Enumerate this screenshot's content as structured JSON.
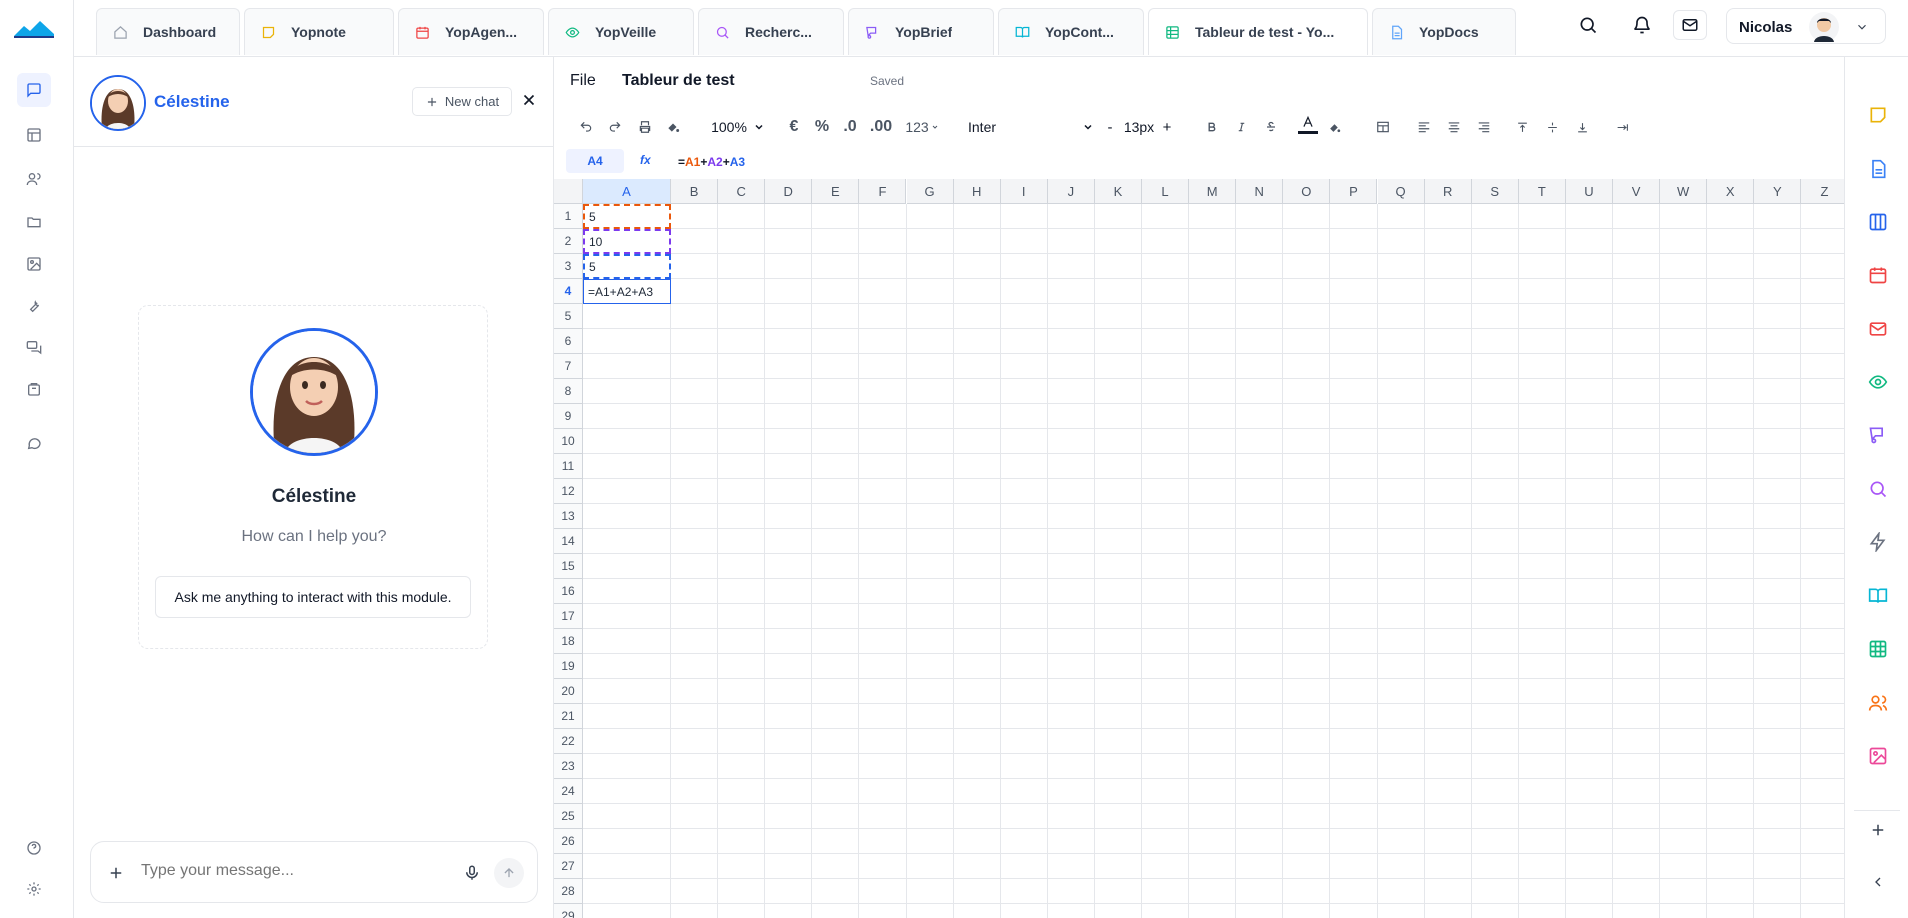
{
  "tabs": [
    {
      "label": "Dashboard",
      "icon": "home-icon"
    },
    {
      "label": "Yopnote",
      "icon": "note-icon"
    },
    {
      "label": "YopAgen...",
      "icon": "calendar-icon"
    },
    {
      "label": "YopVeille",
      "icon": "eye-icon"
    },
    {
      "label": "Recherc...",
      "icon": "search-icon"
    },
    {
      "label": "YopBrief",
      "icon": "brief-icon"
    },
    {
      "label": "YopCont...",
      "icon": "book-icon"
    },
    {
      "label": "Tableur de test - Yo...",
      "icon": "table-icon"
    },
    {
      "label": "YopDocs",
      "icon": "doc-icon"
    }
  ],
  "user": {
    "name": "Nicolas"
  },
  "chat": {
    "assistant_name": "Célestine",
    "new_chat_label": "New chat",
    "greeting": "How can I help you?",
    "suggestion": "Ask me anything to interact with this module.",
    "input_placeholder": "Type your message..."
  },
  "sheet": {
    "file_menu": "File",
    "title": "Tableur de test",
    "status": "Saved",
    "zoom": "100%",
    "currency": "€",
    "percent": "%",
    "dec_less": ".0",
    "dec_more": ".00",
    "number_format": "123",
    "font": "Inter",
    "font_minus": "-",
    "font_size": "13px",
    "font_plus": "+",
    "cell_ref": "A4",
    "fx": "fx",
    "formula_parts": [
      {
        "text": "=",
        "color": "#111827"
      },
      {
        "text": "A1",
        "color": "#ea580c"
      },
      {
        "text": "+",
        "color": "#111827"
      },
      {
        "text": "A2",
        "color": "#7c3aed"
      },
      {
        "text": "+",
        "color": "#111827"
      },
      {
        "text": "A3",
        "color": "#2563eb"
      }
    ],
    "columns": [
      "A",
      "B",
      "C",
      "D",
      "E",
      "F",
      "G",
      "H",
      "I",
      "J",
      "K",
      "L",
      "M",
      "N",
      "O",
      "P",
      "Q",
      "R",
      "S",
      "T",
      "U",
      "V",
      "W",
      "X",
      "Y",
      "Z"
    ],
    "rows": [
      "1",
      "2",
      "3",
      "4",
      "5",
      "6",
      "7",
      "8",
      "9",
      "10",
      "11",
      "12",
      "13",
      "14",
      "15",
      "16",
      "17",
      "18",
      "19",
      "20",
      "21",
      "22",
      "23",
      "24",
      "25",
      "26",
      "27",
      "28",
      "29"
    ],
    "cells": {
      "A1": "5",
      "A2": "10",
      "A3": "5",
      "A4": "=A1+A2+A3"
    },
    "selected_row": "4",
    "selected_col": "A"
  },
  "colors": {
    "accent": "#2563eb",
    "orange": "#ea580c",
    "purple": "#7c3aed"
  }
}
